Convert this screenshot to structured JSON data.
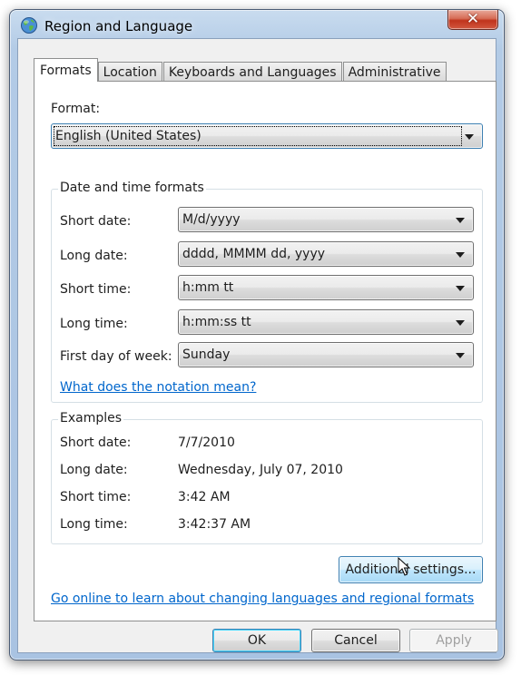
{
  "window": {
    "title": "Region and Language"
  },
  "tabs": [
    {
      "label": "Formats",
      "active": true
    },
    {
      "label": "Location",
      "active": false
    },
    {
      "label": "Keyboards and Languages",
      "active": false
    },
    {
      "label": "Administrative",
      "active": false
    }
  ],
  "format": {
    "label": "Format:",
    "value": "English (United States)"
  },
  "date_time_formats": {
    "legend": "Date and time formats",
    "rows": [
      {
        "label": "Short date:",
        "value": "M/d/yyyy"
      },
      {
        "label": "Long date:",
        "value": "dddd, MMMM dd, yyyy"
      },
      {
        "label": "Short time:",
        "value": "h:mm tt"
      },
      {
        "label": "Long time:",
        "value": "h:mm:ss tt"
      },
      {
        "label": "First day of week:",
        "value": "Sunday"
      }
    ],
    "notation_link": "What does the notation mean?"
  },
  "examples": {
    "legend": "Examples",
    "rows": [
      {
        "label": "Short date:",
        "value": "7/7/2010"
      },
      {
        "label": "Long date:",
        "value": "Wednesday, July 07, 2010"
      },
      {
        "label": "Short time:",
        "value": "3:42 AM"
      },
      {
        "label": "Long time:",
        "value": "3:42:37 AM"
      }
    ]
  },
  "additional_settings_label": "Additional settings...",
  "online_link": "Go online to learn about changing languages and regional formats",
  "buttons": {
    "ok": "OK",
    "cancel": "Cancel",
    "apply": "Apply"
  },
  "icons": {
    "title": "globe-icon",
    "close": "close-icon",
    "dropdown": "chevron-down-icon",
    "cursor": "mouse-pointer-icon"
  },
  "colors": {
    "link": "#0066cc",
    "frame": "#a9c3e2",
    "close": "#c0331c"
  }
}
